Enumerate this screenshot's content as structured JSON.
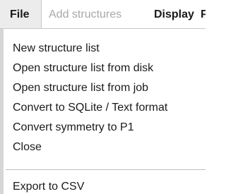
{
  "menubar": {
    "file_label": "File",
    "add_structures_label": "Add structures",
    "display_label": "Display",
    "overflow_label": "Pr"
  },
  "file_menu": {
    "items": [
      "New structure list",
      "Open structure list from disk",
      "Open structure list from job",
      "Convert to SQLite / Text format",
      "Convert symmetry to P1",
      "Close",
      "Export to CSV"
    ]
  }
}
